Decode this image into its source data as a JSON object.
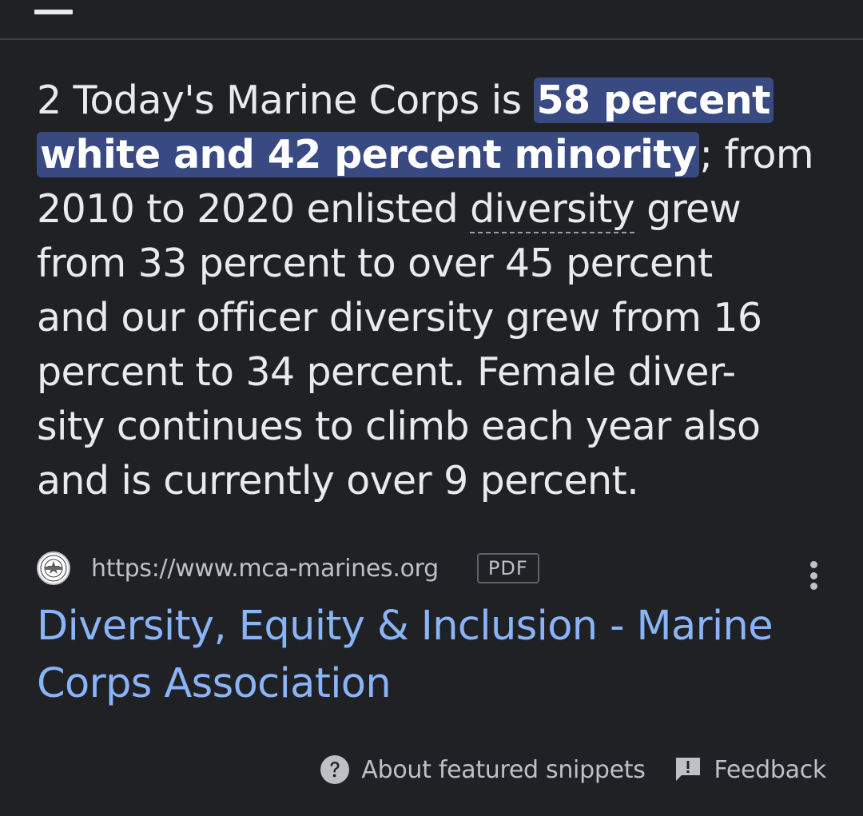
{
  "snippet": {
    "lines": [
      {
        "before": "2 Today's Marine Corps is ",
        "highlight": "58 percent",
        "after": ""
      },
      {
        "before": "",
        "highlight": "white and 42 percent minority",
        "after": "; from"
      },
      {
        "before": "2010 to 2020 enlisted ",
        "dotted": "diversity",
        "after": " grew"
      },
      {
        "text": "from 33 percent to over 45 percent"
      },
      {
        "text": "and our officer diversity grew from 16"
      },
      {
        "text": "percent to 34 percent. Female diver-"
      },
      {
        "text": "sity continues to climb each year also"
      },
      {
        "text": "and is currently over 9 percent."
      }
    ]
  },
  "source": {
    "favicon_icon": "marine-corps-association-logo",
    "url": "https://www.mca-marines.org",
    "file_type": "PDF"
  },
  "result": {
    "title_line1": "Diversity, Equity & Inclusion - Marine",
    "title_line2": "Corps Association"
  },
  "footer": {
    "about_label": "About featured snippets",
    "feedback_label": "Feedback"
  },
  "colors": {
    "background": "#202124",
    "highlight": "#394981",
    "link": "#8ab4f8",
    "text": "#e8eaed"
  }
}
